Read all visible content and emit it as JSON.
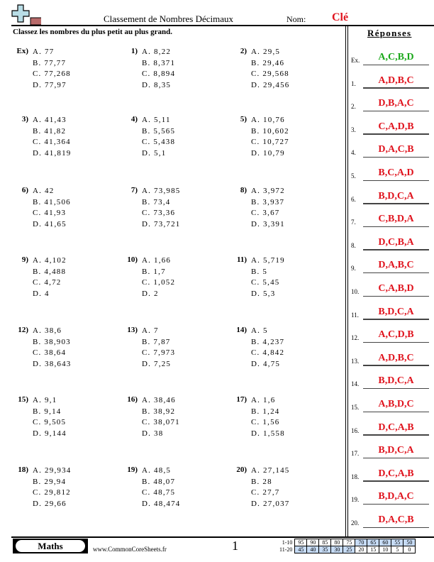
{
  "header": {
    "title": "Classement de Nombres Décimaux",
    "name_label": "Nom:",
    "name_value": "Clé",
    "logo_icon": "plus-minus-icon"
  },
  "instructions": "Classez les nombres du plus petit au plus grand.",
  "answers_title": "Réponses",
  "problems": [
    {
      "num": "Ex)",
      "options": [
        "A. 77",
        "B. 77,77",
        "C. 77,268",
        "D. 77,97"
      ]
    },
    {
      "num": "1)",
      "options": [
        "A. 8,22",
        "B. 8,371",
        "C. 8,894",
        "D. 8,35"
      ]
    },
    {
      "num": "2)",
      "options": [
        "A. 29,5",
        "B. 29,46",
        "C. 29,568",
        "D. 29,456"
      ]
    },
    {
      "num": "3)",
      "options": [
        "A. 41,43",
        "B. 41,82",
        "C. 41,364",
        "D. 41,819"
      ]
    },
    {
      "num": "4)",
      "options": [
        "A. 5,11",
        "B. 5,565",
        "C. 5,438",
        "D. 5,1"
      ]
    },
    {
      "num": "5)",
      "options": [
        "A. 10,76",
        "B. 10,602",
        "C. 10,727",
        "D. 10,79"
      ]
    },
    {
      "num": "6)",
      "options": [
        "A. 42",
        "B. 41,506",
        "C. 41,93",
        "D. 41,65"
      ]
    },
    {
      "num": "7)",
      "options": [
        "A. 73,985",
        "B. 73,4",
        "C. 73,36",
        "D. 73,721"
      ]
    },
    {
      "num": "8)",
      "options": [
        "A. 3,972",
        "B. 3,937",
        "C. 3,67",
        "D. 3,391"
      ]
    },
    {
      "num": "9)",
      "options": [
        "A. 4,102",
        "B. 4,488",
        "C. 4,72",
        "D. 4"
      ]
    },
    {
      "num": "10)",
      "options": [
        "A. 1,66",
        "B. 1,7",
        "C. 1,052",
        "D. 2"
      ]
    },
    {
      "num": "11)",
      "options": [
        "A. 5,719",
        "B. 5",
        "C. 5,45",
        "D. 5,3"
      ]
    },
    {
      "num": "12)",
      "options": [
        "A. 38,6",
        "B. 38,903",
        "C. 38,64",
        "D. 38,643"
      ]
    },
    {
      "num": "13)",
      "options": [
        "A. 7",
        "B. 7,87",
        "C. 7,973",
        "D. 7,25"
      ]
    },
    {
      "num": "14)",
      "options": [
        "A. 5",
        "B. 4,237",
        "C. 4,842",
        "D. 4,75"
      ]
    },
    {
      "num": "15)",
      "options": [
        "A. 9,1",
        "B. 9,14",
        "C. 9,505",
        "D. 9,144"
      ]
    },
    {
      "num": "16)",
      "options": [
        "A. 38,46",
        "B. 38,92",
        "C. 38,071",
        "D. 38"
      ]
    },
    {
      "num": "17)",
      "options": [
        "A. 1,6",
        "B. 1,24",
        "C. 1,56",
        "D. 1,558"
      ]
    },
    {
      "num": "18)",
      "options": [
        "A. 29,934",
        "B. 29,94",
        "C. 29,812",
        "D. 29,66"
      ]
    },
    {
      "num": "19)",
      "options": [
        "A. 48,5",
        "B. 48,07",
        "C. 48,75",
        "D. 48,474"
      ]
    },
    {
      "num": "20)",
      "options": [
        "A. 27,145",
        "B. 28",
        "C. 27,7",
        "D. 27,037"
      ]
    }
  ],
  "answers": [
    {
      "num": "Ex.",
      "value": "A,C,B,D",
      "example": true
    },
    {
      "num": "1.",
      "value": "A,D,B,C"
    },
    {
      "num": "2.",
      "value": "D,B,A,C"
    },
    {
      "num": "3.",
      "value": "C,A,D,B"
    },
    {
      "num": "4.",
      "value": "D,A,C,B"
    },
    {
      "num": "5.",
      "value": "B,C,A,D"
    },
    {
      "num": "6.",
      "value": "B,D,C,A"
    },
    {
      "num": "7.",
      "value": "C,B,D,A"
    },
    {
      "num": "8.",
      "value": "D,C,B,A"
    },
    {
      "num": "9.",
      "value": "D,A,B,C"
    },
    {
      "num": "10.",
      "value": "C,A,B,D"
    },
    {
      "num": "11.",
      "value": "B,D,C,A"
    },
    {
      "num": "12.",
      "value": "A,C,D,B"
    },
    {
      "num": "13.",
      "value": "A,D,B,C"
    },
    {
      "num": "14.",
      "value": "B,D,C,A"
    },
    {
      "num": "15.",
      "value": "A,B,D,C"
    },
    {
      "num": "16.",
      "value": "D,C,A,B"
    },
    {
      "num": "17.",
      "value": "B,D,C,A"
    },
    {
      "num": "18.",
      "value": "D,C,A,B"
    },
    {
      "num": "19.",
      "value": "B,D,A,C"
    },
    {
      "num": "20.",
      "value": "D,A,C,B"
    }
  ],
  "footer": {
    "subject": "Maths",
    "site": "www.CommonCoreSheets.fr",
    "page": "1",
    "score_rows": [
      {
        "label": "1-10",
        "values": [
          "95",
          "90",
          "85",
          "80",
          "75",
          "70",
          "65",
          "60",
          "55",
          "50"
        ]
      },
      {
        "label": "11-20",
        "values": [
          "45",
          "40",
          "35",
          "30",
          "25",
          "20",
          "15",
          "10",
          "5",
          "0"
        ]
      }
    ]
  },
  "colors": {
    "answer": "#e0141e",
    "example_answer": "#1aa81a",
    "score_highlight": "#c6dbf5"
  }
}
